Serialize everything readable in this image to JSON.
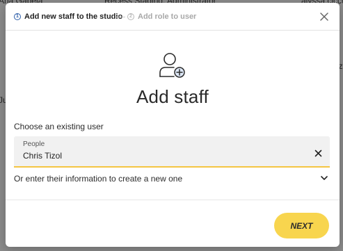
{
  "background": {
    "texts": [
      "Ana Gabela",
      "Recess Staging: Administrator",
      "alyssa.cicco",
      "Ju",
      "nz"
    ]
  },
  "stepper": {
    "steps": [
      {
        "number": "1",
        "label": "Add new staff to the studio",
        "state": "active"
      },
      {
        "number": "2",
        "label": "Add role to user",
        "state": "inactive"
      }
    ]
  },
  "main": {
    "title": "Add staff",
    "existing_user_label": "Choose an existing user",
    "people_field": {
      "label": "People",
      "value": "Chris Tizol"
    },
    "alternative_label": "Or enter their information to create a new one"
  },
  "footer": {
    "next_label": "NEXT"
  },
  "colors": {
    "accent": "#f8d54e",
    "active_step": "#2a5ca8",
    "inactive_step": "#a8a8a8",
    "field_underline": "#f4c542"
  },
  "icons": [
    "close-icon",
    "add-person-icon",
    "clear-icon",
    "chevron-down-icon"
  ]
}
